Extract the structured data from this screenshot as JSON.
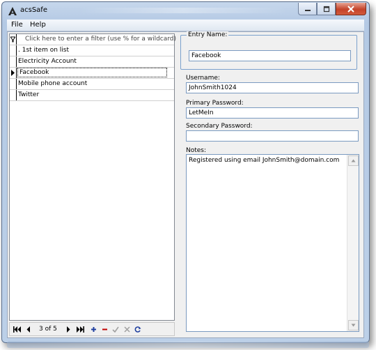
{
  "window": {
    "title": "acsSafe"
  },
  "menu": [
    {
      "label": "File"
    },
    {
      "label": "Help"
    }
  ],
  "filter": {
    "placeholder": "Click here to enter a filter (use % for a wildcard)"
  },
  "list": {
    "items": [
      {
        "label": ". 1st item on list"
      },
      {
        "label": "Electricity Account"
      },
      {
        "label": "Facebook",
        "selected": true
      },
      {
        "label": "Mobile phone account"
      },
      {
        "label": "Twitter"
      }
    ]
  },
  "navigator": {
    "position": "3 of 5"
  },
  "form": {
    "entry_name_label": "Entry Name:",
    "entry_name_value": "Facebook",
    "username_label": "Username:",
    "username_value": "JohnSmith1024",
    "primary_password_label": "Primary Password:",
    "primary_password_value": "LetMeIn",
    "secondary_password_label": "Secondary Password:",
    "secondary_password_value": "",
    "notes_label": "Notes:",
    "notes_value": "Registered using email JohnSmith@domain.com"
  },
  "colors": {
    "nav_blue": "#1f3f9f",
    "nav_red": "#c00000",
    "nav_disabled": "#a0a0a0"
  }
}
